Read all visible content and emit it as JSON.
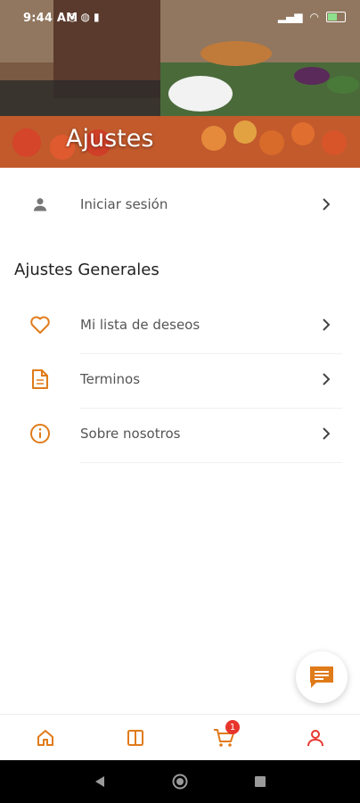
{
  "status_bar": {
    "time": "9:44 AM",
    "notification_icons": [
      "circle-icon",
      "whatsapp-icon",
      "trash-icon"
    ],
    "right_icons": [
      "signal-icon",
      "wifi-icon"
    ]
  },
  "header": {
    "title": "Ajustes"
  },
  "login": {
    "label": "Iniciar sesión"
  },
  "general_settings": {
    "title": "Ajustes Generales",
    "items": [
      {
        "label": "Mi lista de deseos",
        "icon": "heart-icon"
      },
      {
        "label": "Terminos",
        "icon": "document-icon"
      },
      {
        "label": "Sobre nosotros",
        "icon": "info-icon"
      }
    ]
  },
  "bottom_nav": {
    "cart_badge": "1",
    "items": [
      "home-icon",
      "book-icon",
      "cart-icon",
      "user-icon"
    ]
  },
  "colors": {
    "accent": "#e07b1a",
    "text": "#555555",
    "badge": "#e8352c"
  }
}
